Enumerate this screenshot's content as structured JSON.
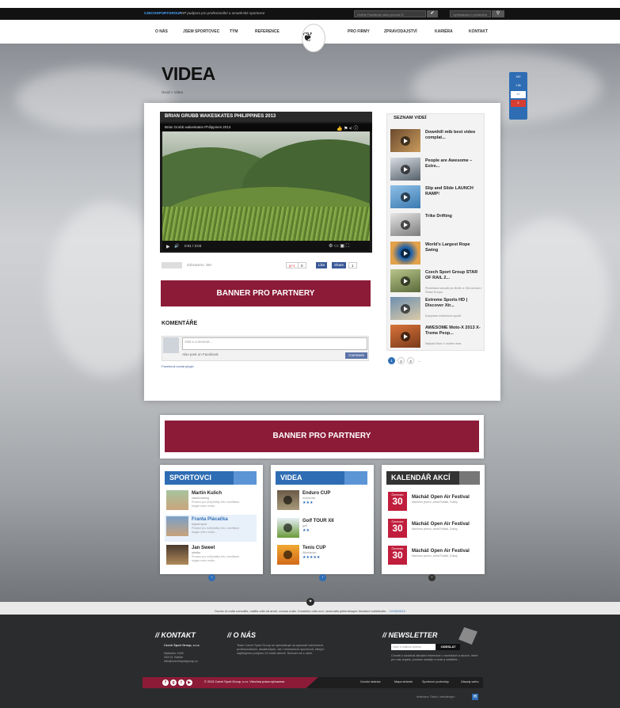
{
  "topbar": {
    "brand": "CZECHSPORTGROUP",
    "tagline": "VIP podpora pro profesionální a amatérské sportovce",
    "search1_placeholder": "Ověřte Facebook nebo prevod IČ",
    "search2_placeholder": "Vyhledávání v předmětu"
  },
  "nav": {
    "items": [
      "O NÁS",
      "JSEM SPORTOVEC",
      "TÝM",
      "REFERENCE",
      "PRO FIRMY",
      "ZPRAVODAJSTVÍ",
      "KARIÉRA",
      "KONTAKT"
    ]
  },
  "page": {
    "title": "VIDEA",
    "breadcrumb": "Úvod  >  Videa"
  },
  "video": {
    "header": "BRIAN GRUBB WAKESKATES PHILIPPINES 2013",
    "subtitle": "Brian Grubb wakeskates Philippines 2013",
    "time": "0:01 / 3:03",
    "views": "Zobrazeno: 35×",
    "gplus_count": "0",
    "like_label": "Like",
    "share_label": "Share",
    "fb_count": "1"
  },
  "banner_label": "BANNER PRO PARTNERY",
  "comments": {
    "title": "KOMENTÁŘE",
    "placeholder": "Add a comment...",
    "post_also": "Also post on Facebook",
    "button": "Comment",
    "plugin": "Facebook social plugin"
  },
  "video_list": {
    "title": "SEZNAM VIDEÍ",
    "items": [
      {
        "title": "Downhill mtb best video complat...",
        "desc": ""
      },
      {
        "title": "People are Awesome – Extre...",
        "desc": ""
      },
      {
        "title": "Slip and Slide LAUNCH RAMP!",
        "desc": ""
      },
      {
        "title": "Trike Drifting",
        "desc": ""
      },
      {
        "title": "World's Largest Rope Swing",
        "desc": ""
      },
      {
        "title": "Czech Sport Group STAR OF RAIL 2...",
        "desc": "Prezentace závodů pro Brněn a Olší závodu v České Evropu"
      },
      {
        "title": "Extreme Sports HD | Discover Xtr...",
        "desc": "Kompilace extrémních sportů"
      },
      {
        "title": "AWESOME Moto-X 2013 X-Treme Peop...",
        "desc": "Nejlepší Moto-X mother dnes"
      }
    ],
    "pages": [
      "1",
      "2",
      "3",
      "..."
    ]
  },
  "share_widget": {
    "like": "442",
    "tweet": "1.5k",
    "count": "10",
    "gplus": "0"
  },
  "sportovci": {
    "title": "SPORTOVCI",
    "items": [
      {
        "name": "Martin Kulich",
        "sport": "wakeboarding",
        "text": "Proseor pro svůj krátký info, maxlfsked slogan nebo motto..."
      },
      {
        "name": "Franta Plácačka",
        "sport": "bojová sport",
        "text": "Proseor pro svůj krátký info, maxlfsked slogan nebo motto..."
      },
      {
        "name": "Jan Sweet",
        "sport": "atletika",
        "text": "Proseor pro svůj krátký info, maxlfsked slogan nebo motto..."
      }
    ]
  },
  "videa_box": {
    "title": "VIDEA",
    "items": [
      {
        "name": "Enduro CUP",
        "sport": "motocross",
        "stars": "★★★"
      },
      {
        "name": "Golf TOUR XII",
        "sport": "golf",
        "stars": "★★"
      },
      {
        "name": "Tenis CUP",
        "sport": "Wimbledon",
        "stars": "★★★★★"
      }
    ]
  },
  "kalendar": {
    "title": "KALENDÁŘ AKCÍ",
    "items": [
      {
        "month": "Červenec",
        "day": "30",
        "name": "Mácháč Open Air Festival",
        "place": "Máchovo jezero, areál Rošlák, Doksy"
      },
      {
        "month": "Červenec",
        "day": "30",
        "name": "Mácháč Open Air Festival",
        "place": "Máchovo jezero, areál Rošlák, Doksy"
      },
      {
        "month": "Červenec",
        "day": "30",
        "name": "Mácháč Open Air Festival",
        "place": "Máchovo jezero, areál Rošlák, Doksy"
      }
    ]
  },
  "tweet": {
    "text": "Donec ut nulla convallis, mattis odio sit amet, cursus nulla. Curabitur odio orci, venenatis pellentesque tincidunt sollicitudin...",
    "time": "19:55/2013"
  },
  "footer": {
    "kontakt_title": "// KONTAKT",
    "company": "Czech Sport Group, s.r.o.",
    "addr1": "Nádražní 1000",
    "addr2": "333 01 Vlašim",
    "email": "info@czechsportgroup.cz",
    "onas_title": "// O NÁS",
    "onas_text": "Team Czech Sport Group se specializuje na sponzoři extrémních, profesionálních, amatérských, ale i rekreačních sportovců, kterým zajišťujeme podporu 24 hodin denně. Seznam se s námi.",
    "newsletter_title": "// NEWSLETTER",
    "newsletter_placeholder": "Vaše e-mailová adresa",
    "newsletter_button": "ODESLAT",
    "newsletter_text": "Chcete-li dostávat aktuální informace o novinkách a akcích, které pro vás chystá, prosíme zadejte e-mail a odešlete...",
    "copyright": "© 2013 Czech Sport Group, s.r.o. Všechna práva vyhrazena",
    "links": [
      "Úvodní stránka",
      "Mapa stránek",
      "Sportovní podmínky",
      "Zásady webu"
    ],
    "credits": "realizace: Dado  |  webdesign:",
    "credits_mark": "H"
  }
}
